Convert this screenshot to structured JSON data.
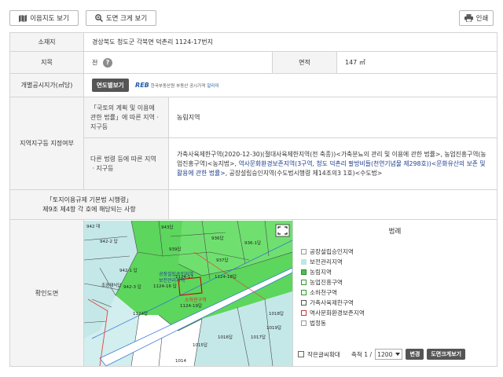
{
  "toolbar": {
    "map_btn": "이음지도 보기",
    "zoom_btn": "도면 크게 보기",
    "print_btn": "인쇄"
  },
  "info": {
    "location_label": "소재지",
    "location_value": "경상북도 청도군 각북면 덕촌리 1124-17번지",
    "jimok_label": "지목",
    "jimok_value": "전",
    "area_label": "면적",
    "area_value": "147 ㎡",
    "price_label": "개별공시지가(㎡당)",
    "yearly_btn": "연도별보기",
    "reb_logo": "REB",
    "reb_name": "한국부동산원",
    "reb_text": "부동산 공시가격",
    "reb_link": "알리미",
    "zone_label": "지역지구등 지정여부",
    "zone_law1_label": "「국토의 계획 및 이용에 관한 법률」에 따른 지역ㆍ지구등",
    "zone_law1_value": "농림지역",
    "zone_law2_label": "다른 법령 등에 따른 지역ㆍ지구등",
    "zone_law2_part1": "가축사육제한구역(2020-12-30)(절대사육제한지역(전 축종))<가축분뇨의 관리 및 이용에 관한 법률>, 농업진흥구역(농업진흥구역)<농지법>, ",
    "zone_law2_part2": "역사문화환경보존지역(3구역, 청도 덕촌리 팔방비들(천연기념물 제298호))<문화유산의 보존 및 활용에 관한 법률>",
    "zone_law2_part3": ", 공장설립승인지역(수도법시행령 제14조의3 1호)<수도법>",
    "regulation_label": "「토지이용규제 기본법 시행령」\n제9조 제4항 각 호에 해당되는 사항",
    "map_label": "확인도면"
  },
  "map": {
    "parcels": [
      "942 대",
      "942-2 답",
      "942-1 답",
      "조경재식답",
      "942-3 답",
      "943답",
      "936답",
      "936-1답",
      "939답",
      "937답",
      "1124-18답",
      "1124-16 답",
      "1124-17",
      "1124-19답",
      "1019답",
      "1016답",
      "1015답",
      "1017답",
      "1018답",
      "1124답",
      "1014"
    ],
    "labels": [
      "공장설립승인지역",
      "보전관리지역",
      "소하천구역"
    ]
  },
  "legend": {
    "title": "범례",
    "items": [
      {
        "label": "공장설립승인지역",
        "color": "#ffffff",
        "border": "#999999"
      },
      {
        "label": "보전관리지역",
        "color": "#bfe6e6",
        "border": "#bfe6e6"
      },
      {
        "label": "농림지역",
        "color": "#4dbe4d",
        "border": "#2d8f2d"
      },
      {
        "label": "농업진흥구역",
        "color": "#ffffff",
        "border": "#2e9a2e"
      },
      {
        "label": "소하천구역",
        "color": "#ffffff",
        "border": "#2e9a2e"
      },
      {
        "label": "가축사육제한구역",
        "color": "#ffffff",
        "border": "#555555"
      },
      {
        "label": "역사문화환경보존지역",
        "color": "#ffffff",
        "border": "#cc3333"
      },
      {
        "label": "법정동",
        "color": "#ffffff",
        "border": "#999999"
      }
    ],
    "small_text": "작은글씨확대",
    "scale_label": "축척 1 /",
    "scale_value": "1200",
    "change_btn": "변경",
    "big_btn": "도면크게보기"
  }
}
